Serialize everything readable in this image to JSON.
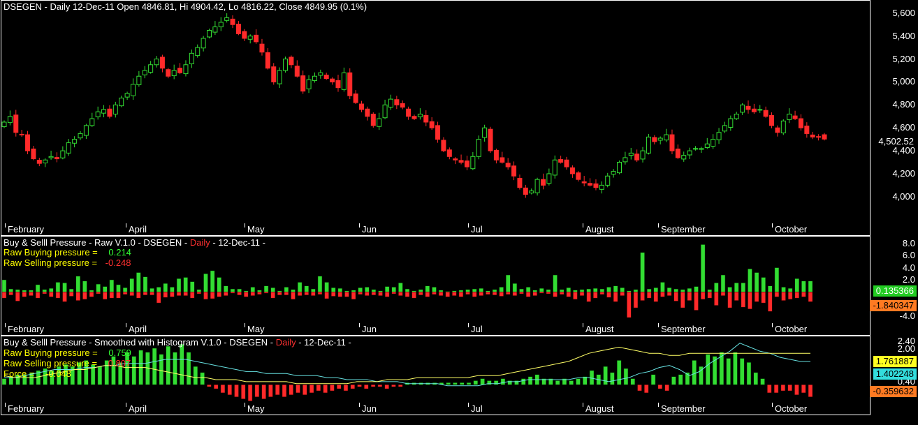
{
  "panel1": {
    "title": "DSEGEN - Daily 12-Dec-11 Open 4846.81, Hi 4904.42, Lo 4816.22, Close 4849.95 (0.1%)",
    "yticks": [
      "5,600",
      "5,400",
      "5,200",
      "5,000",
      "4,800",
      "4,600",
      "4,400",
      "4,200",
      "4,000"
    ],
    "ytick_values": [
      5600,
      5400,
      5200,
      5000,
      4800,
      4600,
      4400,
      4200,
      4000
    ],
    "last_value": "4,502.52",
    "ylim": [
      3780,
      5690
    ]
  },
  "months": [
    "February",
    "April",
    "May",
    "Jun",
    "Jul",
    "August",
    "September",
    "October"
  ],
  "panel2": {
    "title_prefix": "Buy & Selll Pressure - Raw V.1.0 ",
    "title_dash1": " - DSEGEN - ",
    "title_interval": "Daily",
    "title_dash2": " - 12-Dec-11 -",
    "buy_label": "Raw Buying pressure = ",
    "buy_value": "0.214",
    "sell_label": "Raw Selling pressure = ",
    "sell_value": "-0.248",
    "yticks": [
      "8.0",
      "6.0",
      "4.0",
      "2.0",
      "-4.0"
    ],
    "ytick_values": [
      8,
      6,
      4,
      2,
      -4
    ],
    "badge_buy": "0.135366",
    "badge_sell": "-1.840347",
    "ylim": [
      -5,
      9
    ]
  },
  "panel3": {
    "title_prefix": "Buy & Selll Pressure - Smoothed with Histogram V.1.0 ",
    "title_dash1": " - DSEGEN - ",
    "title_interval": "Daily",
    "title_dash2": " - 12-Dec-11 -",
    "buy_label": "Raw Buying pressure = ",
    "buy_value": "0.759",
    "sell_label": "Raw Selling pressure = ",
    "sell_value": "0.807",
    "force_label": "Force = ",
    "force_value": "-0.048",
    "yticks": [
      "2.40",
      "2.00",
      "0.40"
    ],
    "ytick_values": [
      2.4,
      2.0,
      0.4
    ],
    "badge_yellow": "1.761887",
    "badge_cyan": "1.402248",
    "badge_orange": "-0.359632",
    "ylim": [
      -0.6,
      2.6
    ]
  },
  "colors": {
    "up": "#33dd33",
    "down": "#ff2a2a",
    "cyan_line": "#66e0e0",
    "yellow_line": "#ffff66",
    "badge_green": "#22cc22",
    "badge_orange": "#ff7a22",
    "badge_yellow": "#ffff22",
    "badge_cyan": "#33dddd"
  },
  "chart_data": {
    "type": "candlestick",
    "title": "DSEGEN - Daily 12-Dec-11 Open 4846.81, Hi 4904.42, Lo 4816.22, Close 4849.95 (0.1%)",
    "x_labels": [
      "February",
      "April",
      "May",
      "Jun",
      "Jul",
      "August",
      "September",
      "October"
    ],
    "closes": [
      4650,
      4700,
      4560,
      4540,
      4400,
      4330,
      4290,
      4320,
      4350,
      4330,
      4400,
      4470,
      4500,
      4550,
      4620,
      4680,
      4740,
      4760,
      4700,
      4800,
      4860,
      4900,
      4980,
      5050,
      5100,
      5150,
      5200,
      5120,
      5050,
      5100,
      5080,
      5150,
      5250,
      5300,
      5380,
      5450,
      5480,
      5520,
      5560,
      5500,
      5420,
      5380,
      5400,
      5350,
      5260,
      5120,
      5000,
      5100,
      5200,
      5150,
      5050,
      4920,
      5020,
      5050,
      5080,
      5030,
      5000,
      4950,
      5080,
      4880,
      4820,
      4760,
      4700,
      4620,
      4680,
      4800,
      4850,
      4800,
      4780,
      4700,
      4680,
      4720,
      4650,
      4600,
      4500,
      4400,
      4350,
      4320,
      4300,
      4260,
      4350,
      4500,
      4600,
      4400,
      4320,
      4300,
      4260,
      4180,
      4080,
      4020,
      4050,
      4150,
      4100,
      4200,
      4320,
      4300,
      4260,
      4200,
      4150,
      4120,
      4100,
      4080,
      4100,
      4180,
      4220,
      4300,
      4340,
      4380,
      4320,
      4400,
      4520,
      4480,
      4510,
      4540,
      4400,
      4340,
      4360,
      4400,
      4420,
      4420,
      4460,
      4500,
      4560,
      4620,
      4680,
      4720,
      4800,
      4760,
      4740,
      4760,
      4700,
      4620,
      4560,
      4660,
      4720,
      4680,
      4600,
      4550,
      4520,
      4520,
      4502
    ]
  },
  "raw_pressure": {
    "buy": [
      2.0,
      0.5,
      0.4,
      0.3,
      0.3,
      1.2,
      0.4,
      0.6,
      1.6,
      1.5,
      0.5,
      2.6,
      1.8,
      0.3,
      1.3,
      0.9,
      2.0,
      1.2,
      0.7,
      2.2,
      3.2,
      2.5,
      0.6,
      0.8,
      1.4,
      0.8,
      2.2,
      2.4,
      1.7,
      0.4,
      3.0,
      3.5,
      2.4,
      1.0,
      0.5,
      0.5,
      0.2,
      0.8,
      0.3,
      1.0,
      0.7,
      0.2,
      0.8,
      0.4,
      1.6,
      1.0,
      0.5,
      2.6,
      1.6,
      0.7,
      0.6,
      0.2,
      0.3,
      0.7,
      0.8,
      0.4,
      0.2,
      0.9,
      0.8,
      1.5,
      0.5,
      0.2,
      0.4,
      1.0,
      0.8,
      0.3,
      0.1,
      0.2,
      0.3,
      0.4,
      0.5,
      0.6,
      0.2,
      0.4,
      0.8,
      2.8,
      1.4,
      0.5,
      0.8,
      0.3,
      0.6,
      0.4,
      2.8,
      0.4,
      0.7,
      0.3,
      0.4,
      0.5,
      0.6,
      0.5,
      0.8,
      1.0,
      0.7,
      0.2,
      0.4,
      6.5,
      0.5,
      0.7,
      1.6,
      0.7,
      0.5,
      0.4,
      0.6,
      0.9,
      7.8,
      0.4,
      1.5,
      2.8,
      0.8,
      1.5,
      1.5,
      3.8,
      3.2,
      2.4,
      1.0,
      4.0,
      0.8,
      0.6,
      2.2,
      1.8,
      1.8
    ],
    "sell": [
      -1.0,
      -0.5,
      -1.5,
      -0.8,
      -0.6,
      -1.0,
      -0.3,
      -0.8,
      -1.0,
      -1.6,
      -0.7,
      -1.4,
      -1.2,
      -0.8,
      -0.3,
      -1.2,
      -1.0,
      -1.0,
      -0.4,
      -0.6,
      -1.0,
      -0.5,
      -0.5,
      -1.8,
      -0.9,
      -0.8,
      -0.6,
      -0.6,
      -1.0,
      -0.3,
      -1.2,
      -1.1,
      -0.8,
      -0.6,
      -0.2,
      -0.5,
      -0.8,
      -0.6,
      -0.4,
      -0.2,
      -1.0,
      -0.5,
      -0.5,
      -1.2,
      -0.6,
      -0.5,
      -0.6,
      -0.4,
      -1.1,
      -0.7,
      -0.8,
      -0.8,
      -1.2,
      -0.4,
      -0.6,
      -0.5,
      -0.6,
      -0.8,
      -0.3,
      -0.6,
      -0.8,
      -1.0,
      -0.5,
      -0.8,
      -0.4,
      -0.6,
      -0.8,
      -0.6,
      -0.8,
      -0.4,
      -0.8,
      -0.6,
      -0.4,
      -0.5,
      -0.7,
      -0.4,
      -0.6,
      -0.3,
      -0.8,
      -0.6,
      -0.2,
      -0.3,
      -0.8,
      -0.4,
      -0.8,
      -1.2,
      -0.6,
      -1.6,
      -1.0,
      -0.4,
      -0.9,
      -1.6,
      -0.6,
      -4.2,
      -2.6,
      -1.4,
      -1.0,
      -1.6,
      -0.8,
      -0.6,
      -1.5,
      -2.6,
      -1.4,
      -3.0,
      -1.2,
      -1.0,
      -2.2,
      -0.6,
      -2.6,
      -1.4,
      -2.5,
      -2.8,
      -1.6,
      -1.8,
      -3.2,
      -0.8,
      -1.4,
      -1.2,
      -1.0,
      -0.8,
      -1.6
    ]
  },
  "smooth_pressure": {
    "hist": [
      0.3,
      0.4,
      0.5,
      0.5,
      0.6,
      0.7,
      0.8,
      0.7,
      0.9,
      1.0,
      0.9,
      1.1,
      1.2,
      1.0,
      0.9,
      1.2,
      1.4,
      1.1,
      1.6,
      1.4,
      1.7,
      1.6,
      1.8,
      1.5,
      1.9,
      1.6,
      2.0,
      1.6,
      0.9,
      0.6,
      -0.1,
      -0.2,
      -0.4,
      -0.5,
      -0.6,
      -0.7,
      -0.8,
      -0.6,
      -0.7,
      -0.6,
      -0.5,
      -0.6,
      -0.5,
      -0.4,
      -0.5,
      -0.4,
      -0.3,
      -0.4,
      -0.3,
      -0.2,
      -0.3,
      -0.2,
      -0.1,
      -0.2,
      -0.1,
      -0.1,
      -0.2,
      -0.1,
      -0.1,
      0.1,
      0.1,
      0.1,
      0.1,
      0.1,
      0.1,
      0.1,
      0.1,
      0.1,
      0.1,
      0.2,
      0.3,
      0.2,
      0.2,
      0.3,
      0.2,
      0.2,
      0.3,
      0.4,
      0.5,
      0.3,
      0.3,
      0.2,
      0.3,
      0.2,
      0.3,
      0.4,
      0.7,
      0.5,
      0.9,
      0.6,
      1.2,
      0.8,
      0.3,
      -0.3,
      -0.4,
      0.5,
      -0.2,
      -0.3,
      0.4,
      0.5,
      0.6,
      1.2,
      0.9,
      1.5,
      1.4,
      1.6,
      1.3,
      1.6,
      1.3,
      1.1,
      0.6,
      0.3,
      -0.4,
      -0.4,
      -0.3,
      -0.3,
      -0.5,
      -0.4,
      -0.6
    ],
    "cyan": [
      0.6,
      0.6,
      0.7,
      0.8,
      0.9,
      1.0,
      1.0,
      1.0,
      1.1,
      1.1,
      1.2,
      1.2,
      1.3,
      1.3,
      1.3,
      1.4,
      1.5,
      1.5,
      1.5,
      1.4,
      1.3,
      1.2,
      1.1,
      1.0,
      0.9,
      0.9,
      0.8,
      0.8,
      0.8,
      0.7,
      0.7,
      0.7,
      0.6,
      0.6,
      0.5,
      0.5,
      0.5,
      0.4,
      0.4,
      0.4,
      0.3,
      0.3,
      0.3,
      0.3,
      0.2,
      0.2,
      0.2,
      0.2,
      0.3,
      0.3,
      0.4,
      0.4,
      0.5,
      0.5,
      0.5,
      0.5,
      0.5,
      0.6,
      0.6,
      0.5,
      0.4,
      0.5,
      0.6,
      0.8,
      0.9,
      1.1,
      1.2,
      1.0,
      0.7,
      0.9,
      1.3,
      1.6,
      1.9,
      2.3,
      2.1,
      1.9,
      1.8,
      1.6,
      1.5,
      1.4,
      1.4
    ],
    "yellow": [
      0.7,
      0.6,
      0.6,
      0.6,
      0.7,
      0.8,
      0.9,
      1.0,
      1.0,
      1.1,
      1.2,
      1.2,
      1.1,
      1.1,
      1.1,
      1.0,
      0.9,
      0.8,
      0.7,
      0.6,
      0.6,
      0.5,
      0.5,
      0.5,
      0.4,
      0.4,
      0.4,
      0.4,
      0.4,
      0.3,
      0.3,
      0.3,
      0.3,
      0.3,
      0.3,
      0.4,
      0.4,
      0.4,
      0.5,
      0.5,
      0.5,
      0.6,
      0.6,
      0.6,
      0.6,
      0.6,
      0.6,
      0.7,
      0.7,
      0.7,
      0.8,
      0.9,
      1.0,
      1.1,
      1.2,
      1.3,
      1.4,
      1.6,
      1.8,
      1.9,
      2.0,
      2.1,
      2.0,
      1.9,
      1.8,
      1.8,
      1.7,
      1.7,
      1.8,
      1.8,
      1.8,
      1.8,
      1.8,
      1.8,
      1.8,
      1.8,
      1.8,
      1.8,
      1.8,
      1.8,
      1.8
    ]
  }
}
